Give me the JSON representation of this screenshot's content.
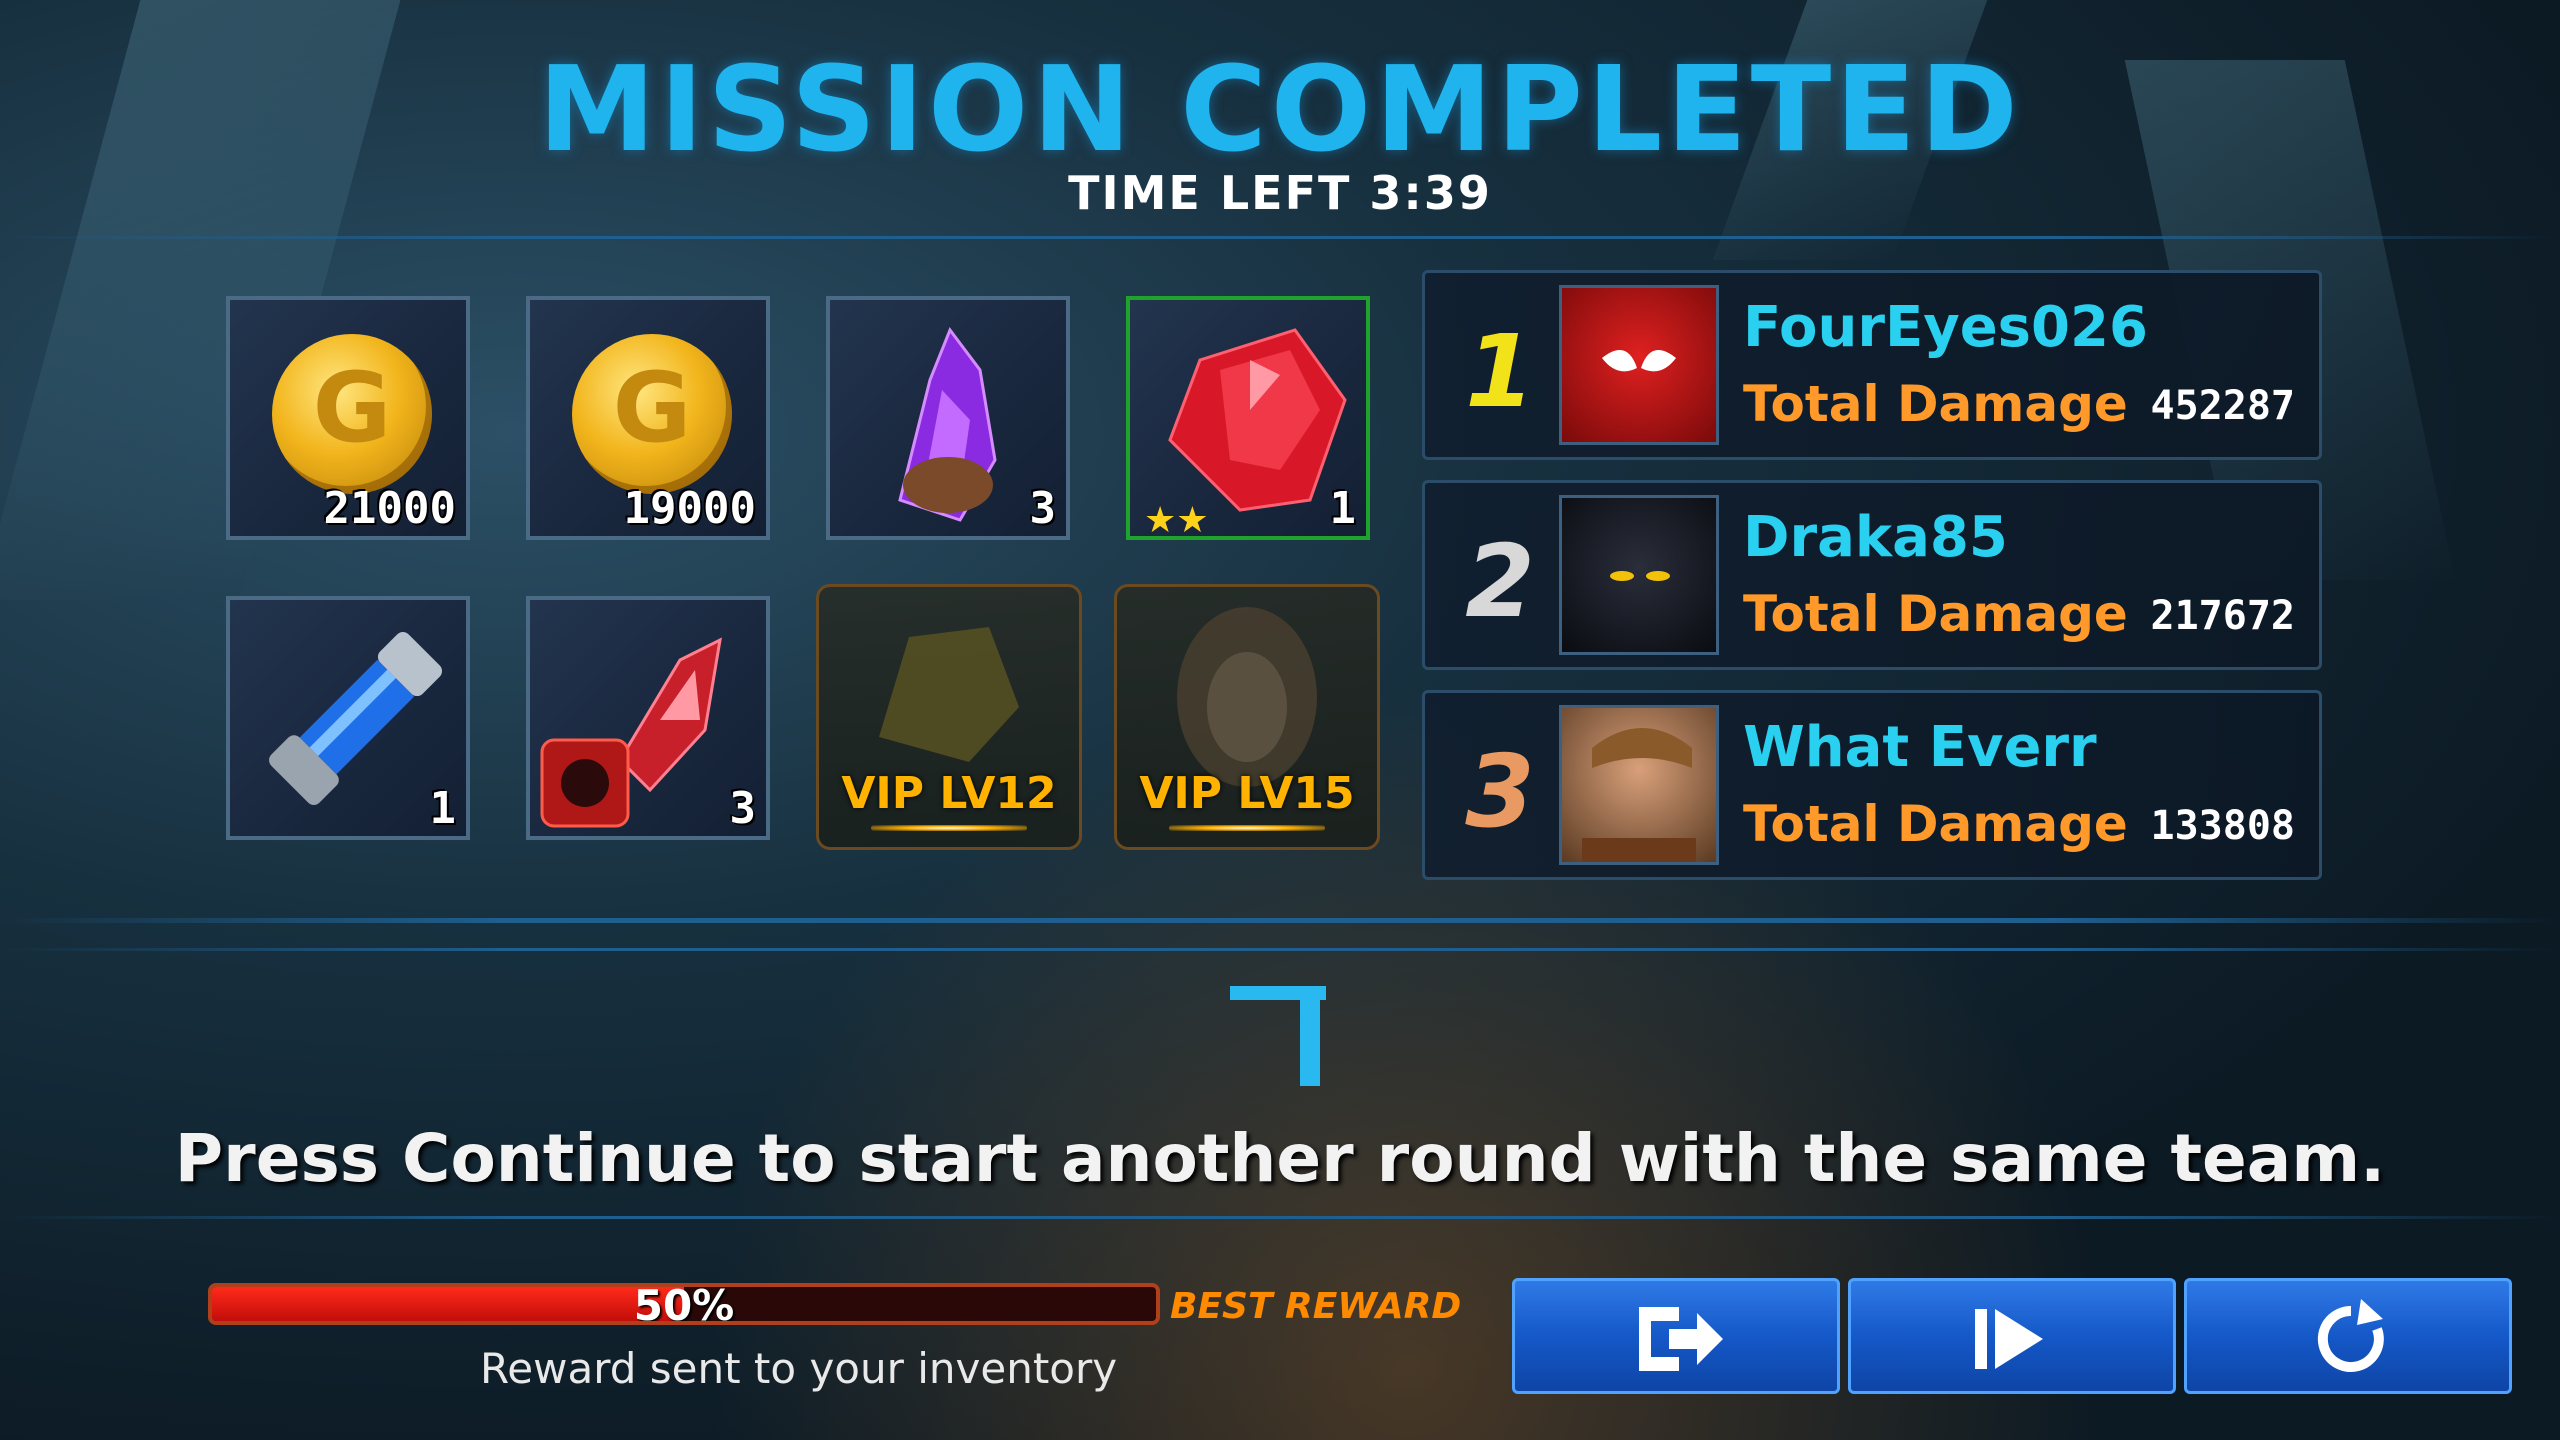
{
  "header": {
    "title": "MISSION COMPLETED",
    "time_left": "TIME LEFT 3:39"
  },
  "rewards": [
    {
      "icon": "gold-coin-icon",
      "count": "21000"
    },
    {
      "icon": "gold-coin-icon",
      "count": "19000"
    },
    {
      "icon": "purple-crystal-icon",
      "count": "3"
    },
    {
      "icon": "red-gem-icon",
      "count": "1",
      "stars": 2
    },
    {
      "icon": "blue-canister-icon",
      "count": "1"
    },
    {
      "icon": "red-fist-crystal-icon",
      "count": "3"
    }
  ],
  "vip_rewards": [
    {
      "icon": "locked-gold-ore-icon",
      "label": "VIP LV12"
    },
    {
      "icon": "locked-hero-portrait-icon",
      "label": "VIP LV15"
    }
  ],
  "rankings": [
    {
      "rank": "1",
      "name": "FourEyes026",
      "damage_label": "Total Damage",
      "damage": "452287",
      "portrait": "spider-man-portrait",
      "color": "#f2e21a"
    },
    {
      "rank": "2",
      "name": "Draka85",
      "damage_label": "Total Damage",
      "damage": "217672",
      "portrait": "black-panther-portrait",
      "color": "#d8d8d8"
    },
    {
      "rank": "3",
      "name": "What Everr",
      "damage_label": "Total Damage",
      "damage": "133808",
      "portrait": "star-lord-portrait",
      "color": "#e89a62"
    }
  ],
  "countdown": "7",
  "prompt": "Press Continue to start another round with the same team.",
  "progress": {
    "value": 0.5,
    "label": "50%",
    "best_reward": "BEST REWARD",
    "note": "Reward sent to your inventory"
  },
  "buttons": [
    {
      "icon": "exit-icon"
    },
    {
      "icon": "continue-icon"
    },
    {
      "icon": "retry-icon"
    }
  ],
  "colors": {
    "title": "#1fb4ee",
    "player_name": "#2ad0f0",
    "damage_label": "#ff9a2a",
    "button": "#1558c8",
    "bar_fill": "#e01810"
  }
}
